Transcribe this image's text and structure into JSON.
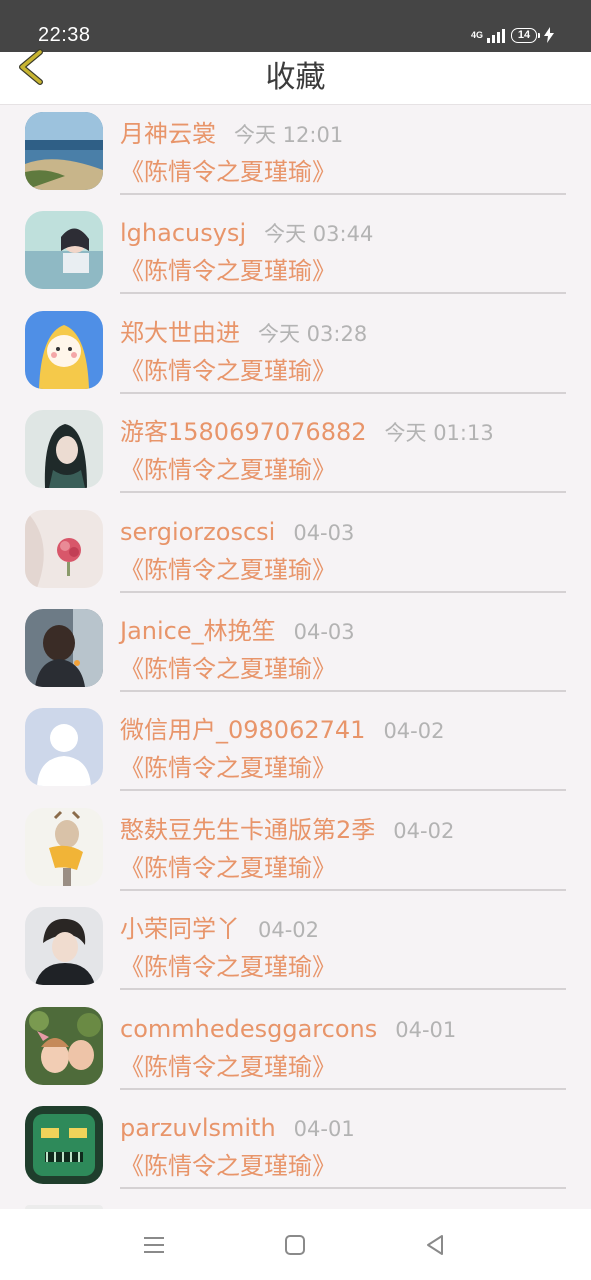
{
  "status_bar": {
    "time": "22:38",
    "network": "4G",
    "battery": "14"
  },
  "header": {
    "title": "收藏"
  },
  "colors": {
    "accent": "#e8956a",
    "muted": "#b3b3b3",
    "back": "#c7b431"
  },
  "favorites": [
    {
      "name": "月神云裳",
      "time": "今天 12:01",
      "book": "《陈情令之夏瑾瑜》"
    },
    {
      "name": "lghacusysj",
      "time": "今天 03:44",
      "book": "《陈情令之夏瑾瑜》"
    },
    {
      "name": "郑大世由进",
      "time": "今天 03:28",
      "book": "《陈情令之夏瑾瑜》"
    },
    {
      "name": "游客1580697076882",
      "time": "今天 01:13",
      "book": "《陈情令之夏瑾瑜》"
    },
    {
      "name": "sergiorzoscsi",
      "time": "04-03",
      "book": "《陈情令之夏瑾瑜》"
    },
    {
      "name": "Janice_林挽笙",
      "time": "04-03",
      "book": "《陈情令之夏瑾瑜》"
    },
    {
      "name": "微信用户_098062741",
      "time": "04-02",
      "book": "《陈情令之夏瑾瑜》"
    },
    {
      "name": "憨麸豆先生卡通版第2季",
      "time": "04-02",
      "book": "《陈情令之夏瑾瑜》"
    },
    {
      "name": "小荣同学丫",
      "time": "04-02",
      "book": "《陈情令之夏瑾瑜》"
    },
    {
      "name": "commhedesggarcons",
      "time": "04-01",
      "book": "《陈情令之夏瑾瑜》"
    },
    {
      "name": "parzuvlsmith",
      "time": "04-01",
      "book": "《陈情令之夏瑾瑜》"
    }
  ]
}
